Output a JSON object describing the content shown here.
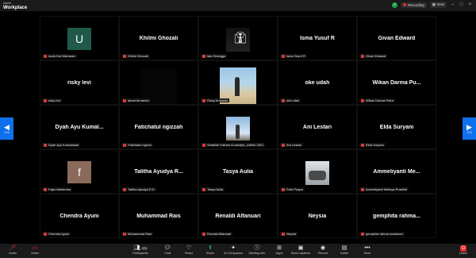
{
  "topbar": {
    "brand_small": "zoom",
    "brand_main": "Workplace",
    "recording_label": "Recording",
    "view_label": "View",
    "icons": [
      "shield-check-icon",
      "record-dot-icon",
      "grid-view-icon",
      "minimize-icon",
      "maximize-icon",
      "close-icon"
    ]
  },
  "nav": {
    "prev_page": "1/10",
    "next_page": "1/10"
  },
  "participants": [
    {
      "display": "",
      "label": "Aulia Dwi Maharani",
      "avatar": {
        "letter": "U",
        "bg": "#1f5a4a"
      }
    },
    {
      "display": "Khilmi Ghozali",
      "label": "Khilmi Ghozali"
    },
    {
      "display": "",
      "label": "lalu Erlangga",
      "photo": "suit"
    },
    {
      "display": "Isma Yusuf R",
      "label": "Isma Yusuf R"
    },
    {
      "display": "Givan Edward",
      "label": "Givan Edward"
    },
    {
      "display": "risky levi",
      "label": "risky levi"
    },
    {
      "display": "",
      "label": "akhat fernando",
      "photo": "black"
    },
    {
      "display": "",
      "label": "Rizky Ardiantis",
      "photo": "beach"
    },
    {
      "display": "oke udah",
      "label": "oke udah"
    },
    {
      "display": "Wikan Darma Pu...",
      "label": "Wikan Darma Putra"
    },
    {
      "display": "Dyah Ayu Kumal...",
      "label": "Dyah Ayu Kumalasari"
    },
    {
      "display": "Fatichatul ngizzah",
      "label": "Fatichatul ngizzh"
    },
    {
      "display": "",
      "label": "Shabilah Fathan Al-addiyis_UAMU 2021",
      "photo": "sky"
    },
    {
      "display": "Ani Lestari",
      "label": "Ani Lestari"
    },
    {
      "display": "Elda Suryani",
      "label": "Elda Suryani"
    },
    {
      "display": "",
      "label": "Fajar Mahendra",
      "avatar": {
        "letter": "f",
        "bg": "#8a6a5a"
      }
    },
    {
      "display": "Talitha Ayudya R...",
      "label": "Talitha Ayudya R.D"
    },
    {
      "display": "Tasya Aulia",
      "label": "Tasya Aulia"
    },
    {
      "display": "",
      "label": "Putri Puspa",
      "photo": "group"
    },
    {
      "display": "Ammeliyanti Me...",
      "label": "Ammeliyanti Melicya Prasthiri"
    },
    {
      "display": "Chendra Ayuni",
      "label": "Chendra Ayuni"
    },
    {
      "display": "Muhammad Rais",
      "label": "Muhammad Rais"
    },
    {
      "display": "Renaldi Alfanuari",
      "label": "Renaldi Alfanuari"
    },
    {
      "display": "Neysia",
      "label": "Neysia"
    },
    {
      "display": "gemphita rahma...",
      "label": "gemphita rahma maharani"
    }
  ],
  "toolbar": {
    "audio": "Audio",
    "video": "Video",
    "participants": "Participants",
    "participants_count": "270",
    "chat": "Chat",
    "react": "React",
    "share": "Share",
    "ai_companion": "AI Companion",
    "meeting_info": "Meeting info",
    "apps": "Apps",
    "show_captions": "Show captions",
    "record": "Record",
    "notes": "Notes",
    "more": "More",
    "leave": "Leave"
  },
  "colors": {
    "accent": "#0e71eb",
    "danger": "#e02c2c",
    "share": "#1aa34a"
  }
}
